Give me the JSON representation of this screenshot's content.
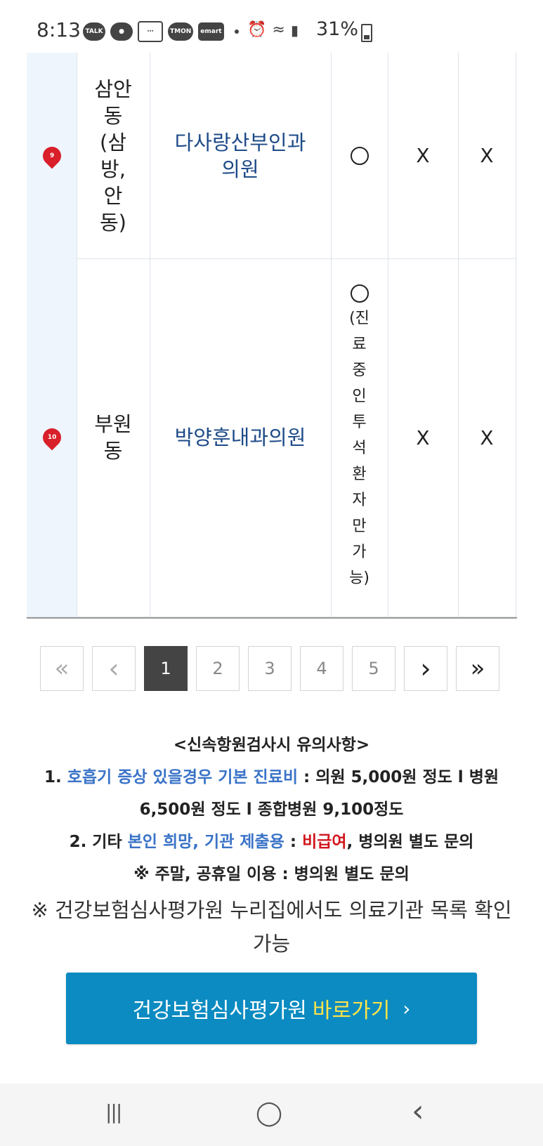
{
  "status_bar": {
    "time": "8:13",
    "notif_icons": [
      "TALK",
      "chat-icon",
      "message-icon",
      "TMON",
      "emart"
    ],
    "battery": "31%"
  },
  "table": {
    "rows": [
      {
        "pin": "9",
        "dong": "삼안\n동\n(삼\n방,\n안\n동)",
        "name": "다사랑산부인과\n의원",
        "o_note": "",
        "x1": "X",
        "x2": "X"
      },
      {
        "pin": "10",
        "dong": "부원\n동",
        "name": "박양훈내과의원",
        "o_note": "(진\n료\n중\n인\n투\n석\n환\n자\n만\n가\n능)",
        "x1": "X",
        "x2": "X"
      }
    ]
  },
  "pagination": {
    "first": "«",
    "prev": "‹",
    "pages": [
      "1",
      "2",
      "3",
      "4",
      "5"
    ],
    "next": "›",
    "last": "»"
  },
  "notes": {
    "title": "<신속항원검사시 유의사항>",
    "l1_prefix": "1. ",
    "l1_blue": "호흡기 증상 있을경우 기본 진료비",
    "l1_rest": " : 의원 5,000원 정도 l 병원 6,500원 정도 l 종합병원 9,100정도",
    "l2_prefix": "2. 기타 ",
    "l2_blue": "본인 희망, 기관 제출용",
    "l2_mid": " : ",
    "l2_red": "비급여",
    "l2_rest": ", 병의원 별도 문의",
    "l3": "※ 주말, 공휴일 이용 : 병의원 별도 문의",
    "ref": "※ 건강보험심사평가원 누리집에서도 의료기관 목록 확인 가능"
  },
  "cta": {
    "label": "건강보험심사평가원",
    "accent": "바로가기",
    "chevron": "›"
  },
  "navbar": {
    "recents": "|||",
    "home": "◯",
    "back": "‹"
  }
}
